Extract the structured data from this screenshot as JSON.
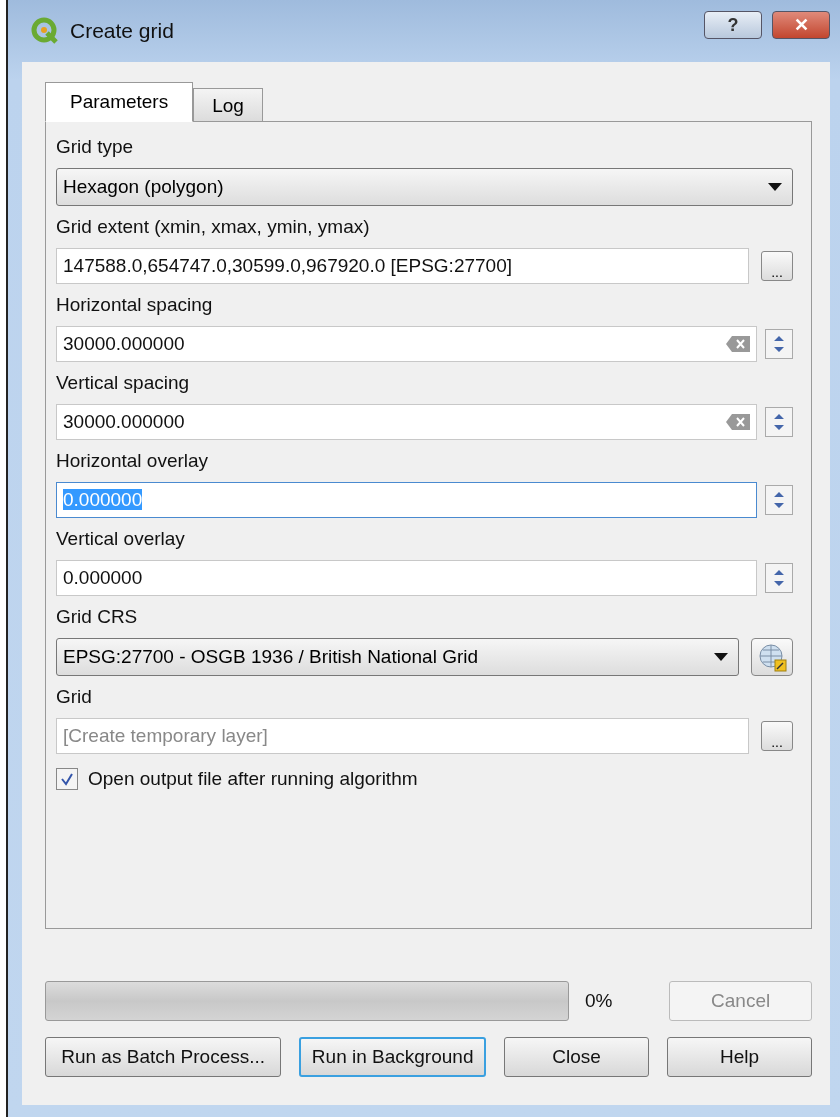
{
  "window": {
    "title": "Create grid",
    "help_button": "?",
    "close_button": "✕"
  },
  "tabs": [
    {
      "label": "Parameters",
      "selected": true
    },
    {
      "label": "Log",
      "selected": false
    }
  ],
  "fields": [
    {
      "label": "Grid type",
      "kind": "select",
      "value": "Hexagon (polygon)",
      "focused": false
    },
    {
      "label": "Grid extent (xmin, xmax, ymin, ymax)",
      "kind": "browse",
      "value": "147588.0,654747.0,30599.0,967920.0 [EPSG:27700]",
      "button": "...",
      "focused": false
    },
    {
      "label": "Horizontal spacing",
      "kind": "spin_clear",
      "value": "30000.000000",
      "focused": false
    },
    {
      "label": "Vertical spacing",
      "kind": "spin_clear",
      "value": "30000.000000",
      "focused": false
    },
    {
      "label": "Horizontal overlay",
      "kind": "spin",
      "value": "0.000000",
      "focused": true
    },
    {
      "label": "Vertical overlay",
      "kind": "spin",
      "value": "0.000000",
      "focused": false
    },
    {
      "label": "Grid CRS",
      "kind": "crs",
      "value": "EPSG:27700 - OSGB 1936 / British National Grid",
      "focused": false
    },
    {
      "label": "Grid",
      "kind": "output",
      "placeholder": "[Create temporary layer]",
      "button": "...",
      "focused": false
    }
  ],
  "open_output": {
    "label": "Open output file after running algorithm",
    "checked": true
  },
  "progress": {
    "level": 0,
    "reading": "0%"
  },
  "cancel_button": {
    "label": "Cancel",
    "disabled": true
  },
  "buttons": [
    {
      "label": "Run as Batch Process...",
      "default": false
    },
    {
      "label": "Run in Background",
      "default": true
    },
    {
      "label": "Close",
      "default": false
    },
    {
      "label": "Help",
      "default": false
    }
  ]
}
